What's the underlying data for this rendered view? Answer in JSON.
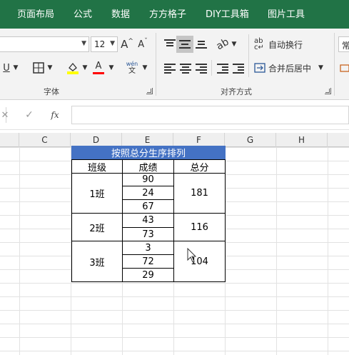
{
  "ribbon_tabs": [
    "页面布局",
    "公式",
    "数据",
    "方方格子",
    "DIY工具箱",
    "图片工具"
  ],
  "font": {
    "name": "",
    "size": "12",
    "grow_label": "A",
    "shrink_label": "A",
    "underline_label": "U",
    "font_color_label": "A",
    "phonetic_top": "wén",
    "phonetic_bottom": "文",
    "group_label": "字体"
  },
  "alignment": {
    "wrap_text": "自动换行",
    "merge_center": "合并后居中",
    "group_label": "对齐方式"
  },
  "number": {
    "format": "常"
  },
  "formula_bar": {
    "cancel": "✕",
    "enter": "✓",
    "fx": "fx",
    "value": ""
  },
  "columns": [
    "C",
    "D",
    "E",
    "F",
    "G",
    "H"
  ],
  "table": {
    "title": "按照总分生序排列",
    "headers": [
      "班级",
      "成绩",
      "总分"
    ],
    "groups": [
      {
        "class": "1班",
        "scores": [
          "90",
          "24",
          "67"
        ],
        "total": "181"
      },
      {
        "class": "2班",
        "scores": [
          "43",
          "73"
        ],
        "total": "116"
      },
      {
        "class": "3班",
        "scores": [
          "3",
          "72",
          "29"
        ],
        "total": "104"
      }
    ]
  },
  "colors": {
    "ribbon_green": "#217346",
    "title_fill": "#4472C4",
    "highlight_yellow": "#ffff00",
    "font_red": "#ff0000"
  }
}
